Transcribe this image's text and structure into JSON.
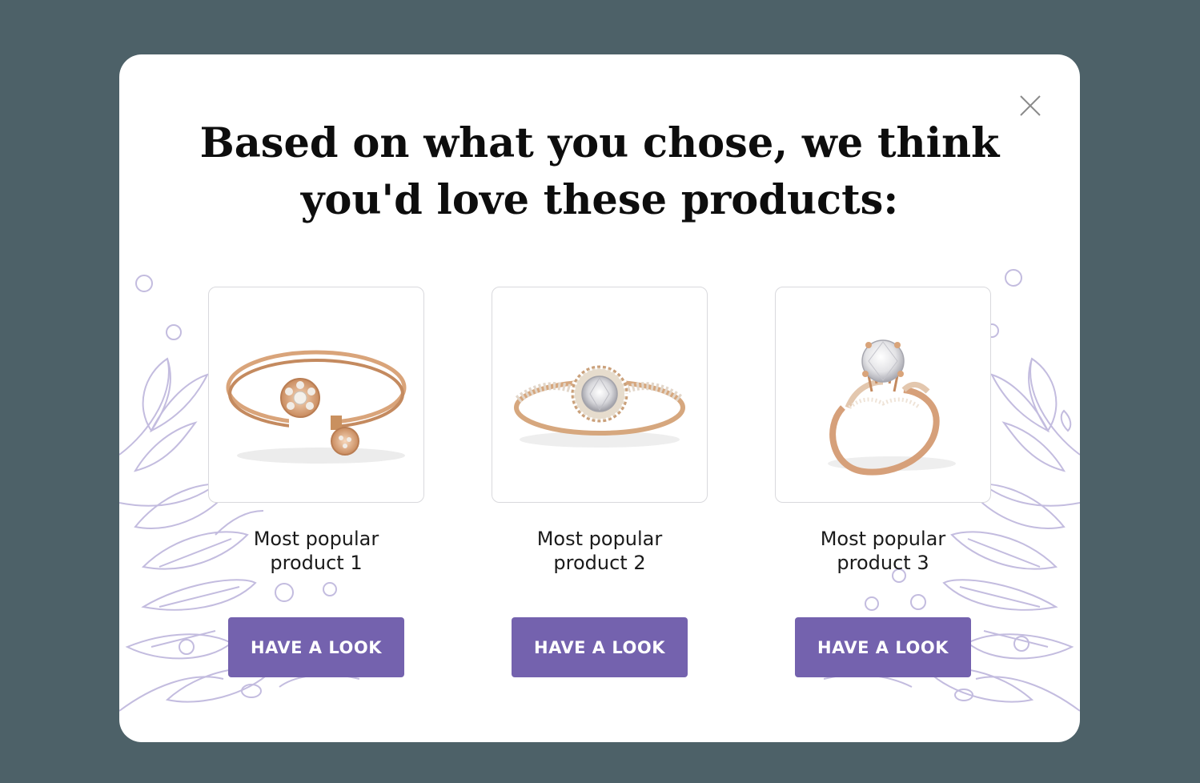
{
  "modal": {
    "title": "Based on what you chose, we think you'd love these products:",
    "close_icon": "close-icon"
  },
  "products": [
    {
      "name": "Most popular\nproduct 1",
      "cta": "HAVE A LOOK",
      "image": "open-bangle-bracelet"
    },
    {
      "name": "Most popular\nproduct 2",
      "cta": "HAVE A LOOK",
      "image": "halo-diamond-ring"
    },
    {
      "name": "Most popular\nproduct 3",
      "cta": "HAVE A LOOK",
      "image": "solitaire-ring"
    }
  ],
  "colors": {
    "backdrop": "#4d6168",
    "modal_bg": "#ffffff",
    "accent": "#7462ae",
    "decoration": "#c3bcdf",
    "gold": "#d9a47a"
  }
}
